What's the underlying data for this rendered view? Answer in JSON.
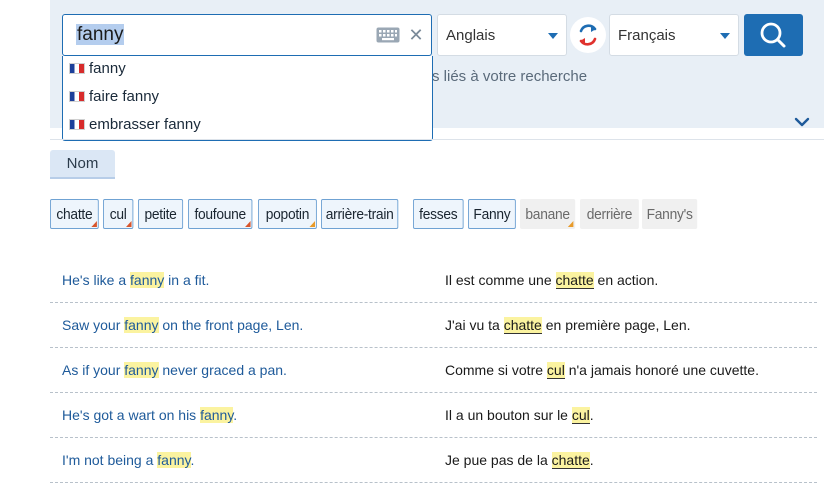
{
  "search": {
    "value": "fanny"
  },
  "suggestions": [
    "fanny",
    "faire fanny",
    "embrasser fanny"
  ],
  "language": {
    "source": "Anglais",
    "target": "Français"
  },
  "related_text": "s liés à votre recherche",
  "pos_tag": "Nom",
  "chips": [
    "chatte",
    "cul",
    "petite",
    "foufoune",
    "popotin",
    "arrière-train",
    "fesses",
    "Fanny",
    "banane",
    "derrière",
    "Fanny's"
  ],
  "examples": [
    {
      "src_pre": "He's like a ",
      "src_hl": "fanny",
      "src_post": " in a fit.",
      "dst_pre": "Il est comme une ",
      "dst_hl": "chatte",
      "dst_post": " en action."
    },
    {
      "src_pre": "Saw your ",
      "src_hl": "fanny",
      "src_post": " on the front page, Len.",
      "dst_pre": "J'ai vu ta ",
      "dst_hl": "chatte",
      "dst_post": " en première page, Len."
    },
    {
      "src_pre": "As if your ",
      "src_hl": "fanny",
      "src_post": " never graced a pan.",
      "dst_pre": "Comme si votre ",
      "dst_hl": "cul",
      "dst_post": " n'a jamais honoré une cuvette."
    },
    {
      "src_pre": "He's got a wart on his ",
      "src_hl": "fanny",
      "src_post": ".",
      "dst_pre": "Il a un bouton sur le ",
      "dst_hl": "cul",
      "dst_post": "."
    },
    {
      "src_pre": "I'm not being a ",
      "src_hl": "fanny",
      "src_post": ".",
      "dst_pre": "Je pue pas de la ",
      "dst_hl": "chatte",
      "dst_post": "."
    }
  ],
  "colors": {
    "accent": "#1e6db3",
    "highlight": "#fbf3a0",
    "header_bg": "#e8eff6"
  },
  "icons": [
    "keyboard-icon",
    "close-icon",
    "swap-icon",
    "search-icon",
    "chevron-down-icon",
    "flag-fr-icon"
  ]
}
